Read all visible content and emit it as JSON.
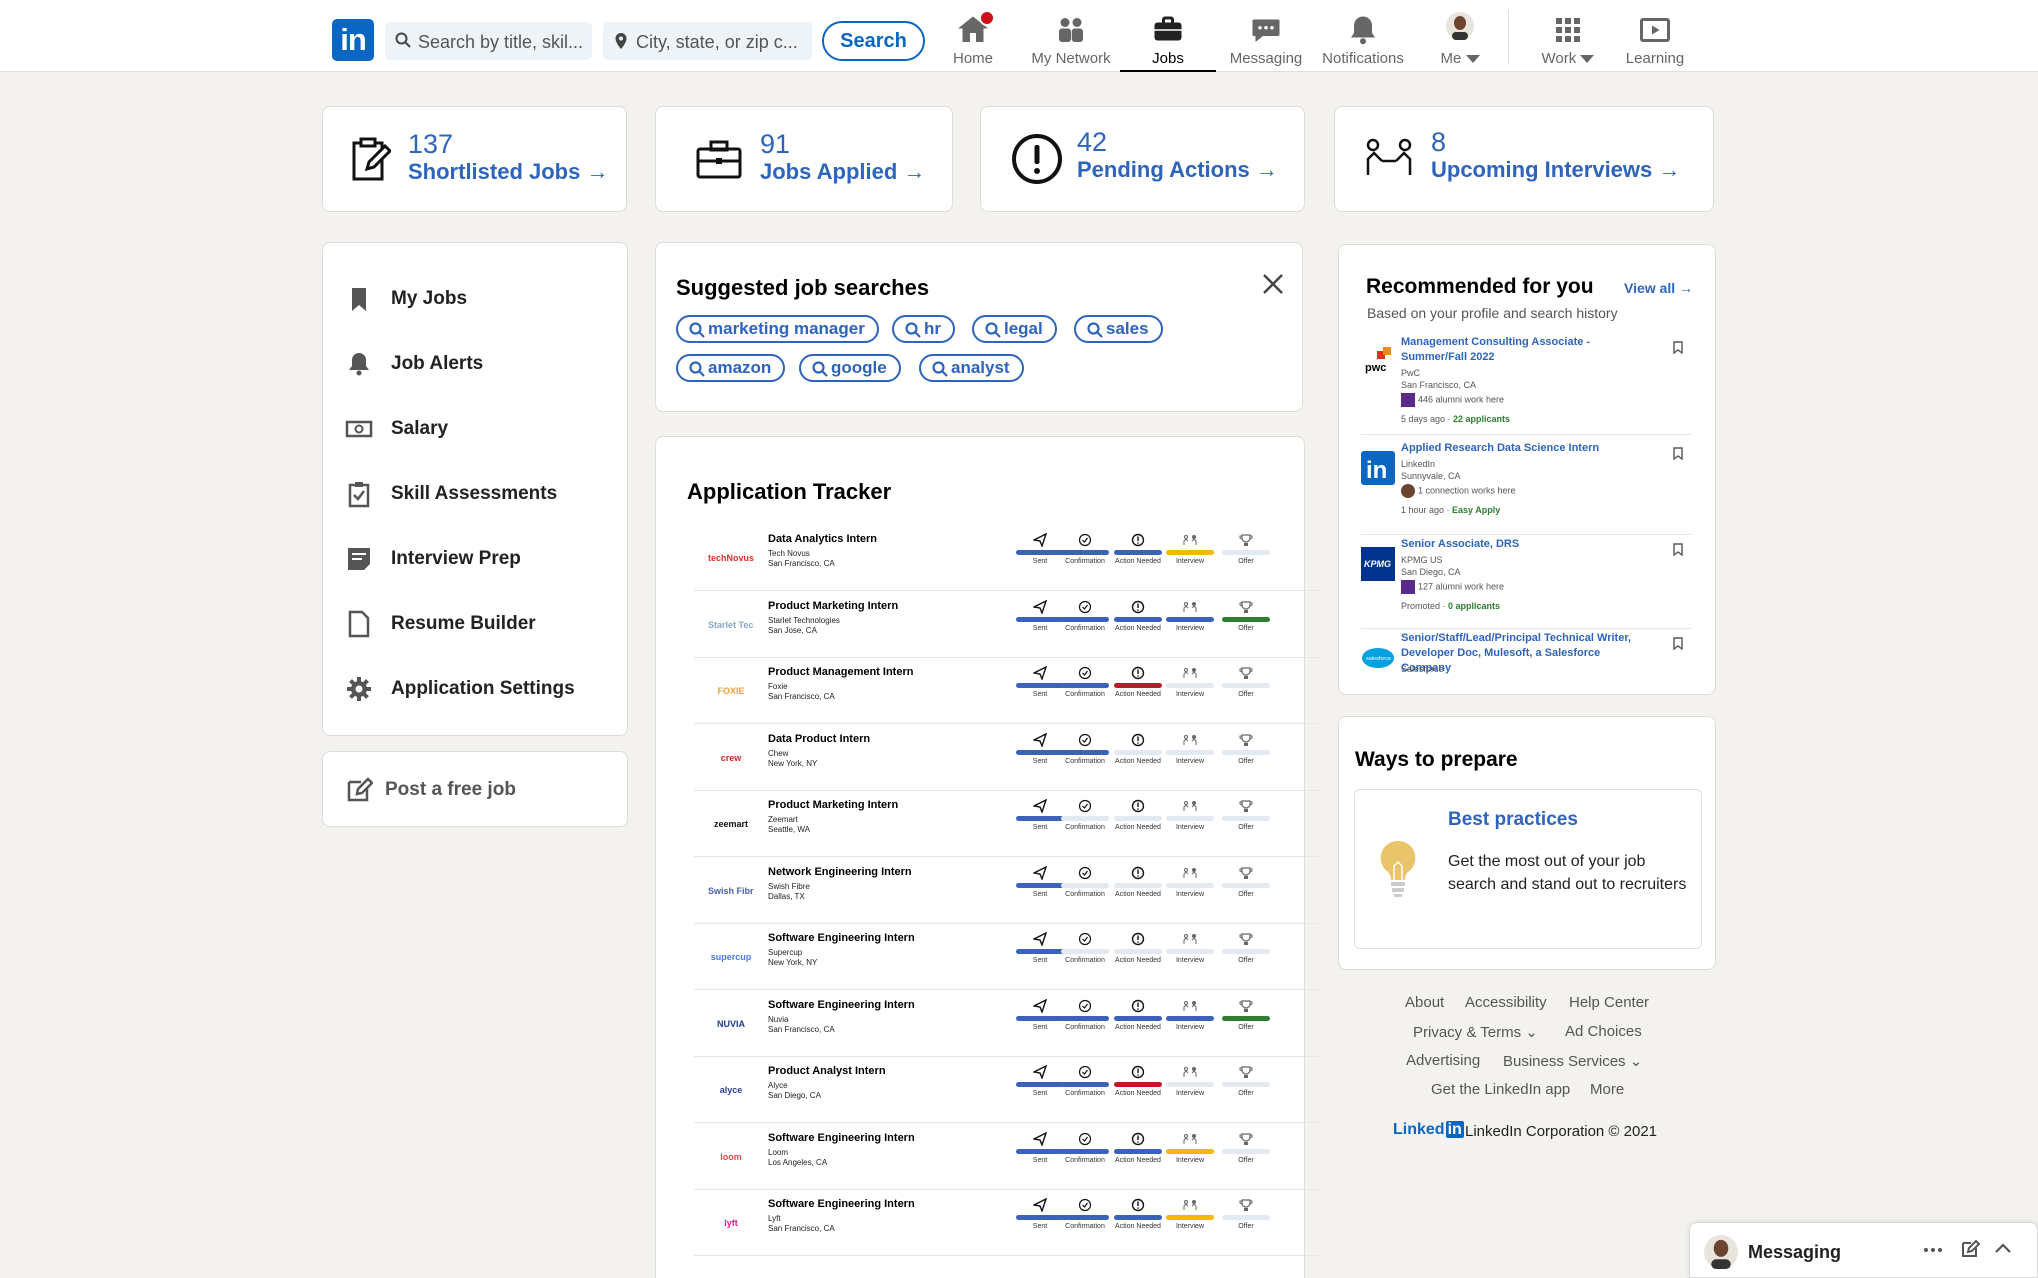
{
  "nav": {
    "logo": "in",
    "search_placeholder": "Search by title, skil...",
    "location_placeholder": "City, state, or zip c...",
    "search_button": "Search",
    "items": [
      {
        "label": "Home"
      },
      {
        "label": "My Network"
      },
      {
        "label": "Jobs"
      },
      {
        "label": "Messaging"
      },
      {
        "label": "Notifications"
      },
      {
        "label": "Me"
      },
      {
        "label": "Work"
      },
      {
        "label": "Learning"
      }
    ]
  },
  "stats": [
    {
      "number": "137",
      "label": "Shortlisted Jobs →"
    },
    {
      "number": "91",
      "label": "Jobs Applied →"
    },
    {
      "number": "42",
      "label": "Pending Actions →"
    },
    {
      "number": "8",
      "label": "Upcoming Interviews →"
    }
  ],
  "sidebar": {
    "items": [
      {
        "label": "My Jobs",
        "icon": "bookmark-icon"
      },
      {
        "label": "Job Alerts",
        "icon": "bell-icon"
      },
      {
        "label": "Salary",
        "icon": "money-icon"
      },
      {
        "label": "Skill Assessments",
        "icon": "clipboard-check-icon"
      },
      {
        "label": "Interview Prep",
        "icon": "notes-icon"
      },
      {
        "label": "Resume Builder",
        "icon": "document-icon"
      },
      {
        "label": "Application Settings",
        "icon": "gear-icon"
      }
    ],
    "post_job": "Post a free job"
  },
  "suggested": {
    "title": "Suggested job searches",
    "pills": [
      "marketing manager",
      "hr",
      "legal",
      "sales",
      "amazon",
      "google",
      "analyst"
    ]
  },
  "tracker": {
    "title": "Application Tracker",
    "stages": [
      "Sent",
      "Confirmation",
      "Action Needed",
      "Interview",
      "Offer"
    ],
    "colors": {
      "done": "#3a62b8",
      "pending": "#e4e8ef",
      "action": "#c0182a",
      "interview": "#f5b800",
      "offer": "#2f7d32"
    },
    "rows": [
      {
        "title": "Data Analytics Intern",
        "company": "Tech Novus",
        "location": "San Francisco, CA",
        "logo": "techNovus",
        "logo_color": "#d9342b",
        "status": [
          "done",
          "done",
          "done",
          "interview",
          "pending"
        ]
      },
      {
        "title": "Product Marketing Intern",
        "company": "Starlet Technologies",
        "location": "San Jose, CA",
        "logo": "Starlet Technologies",
        "logo_color": "#8aa6c8",
        "status": [
          "done",
          "done",
          "done",
          "done",
          "offer"
        ]
      },
      {
        "title": "Product Management Intern",
        "company": "Foxie",
        "location": "San Francisco, CA",
        "logo": "FOXIE",
        "logo_color": "#e8a23a",
        "status": [
          "done",
          "done",
          "action",
          "pending",
          "pending"
        ]
      },
      {
        "title": "Data Product Intern",
        "company": "Chew",
        "location": "New York, NY",
        "logo": "crew",
        "logo_color": "#d8202a",
        "status": [
          "done",
          "done",
          "pending",
          "pending",
          "pending"
        ]
      },
      {
        "title": "Product Marketing Intern",
        "company": "Zeemart",
        "location": "Seattle, WA",
        "logo": "zeemart",
        "logo_color": "#111111",
        "status": [
          "done",
          "pending",
          "pending",
          "pending",
          "pending"
        ]
      },
      {
        "title": "Network Engineering Intern",
        "company": "Swish Fibre",
        "location": "Dallas, TX",
        "logo": "Swish Fibre",
        "logo_color": "#4a5fb0",
        "status": [
          "done",
          "pending",
          "pending",
          "pending",
          "pending"
        ]
      },
      {
        "title": "Software Engineering Intern",
        "company": "Supercup",
        "location": "New York, NY",
        "logo": "supercup",
        "logo_color": "#4a7ae0",
        "status": [
          "done",
          "pending",
          "pending",
          "pending",
          "pending"
        ]
      },
      {
        "title": "Software Engineering Intern",
        "company": "Nuvia",
        "location": "San Francisco, CA",
        "logo": "NUVIA",
        "logo_color": "#1e3d96",
        "status": [
          "done",
          "done",
          "done",
          "done",
          "offer"
        ]
      },
      {
        "title": "Product Analyst Intern",
        "company": "Alyce",
        "location": "San Diego, CA",
        "logo": "alyce",
        "logo_color": "#2a3fa0",
        "status": [
          "done",
          "done",
          "action",
          "pending",
          "pending"
        ]
      },
      {
        "title": "Software Engineering Intern",
        "company": "Loom",
        "location": "Los Angeles, CA",
        "logo": "loom",
        "logo_color": "#e0484f",
        "status": [
          "done",
          "done",
          "done",
          "interview",
          "pending"
        ]
      },
      {
        "title": "Software Engineering Intern",
        "company": "Lyft",
        "location": "San Francisco, CA",
        "logo": "lyft",
        "logo_color": "#e9158c",
        "status": [
          "done",
          "done",
          "done",
          "interview",
          "pending"
        ]
      }
    ]
  },
  "recommended": {
    "title": "Recommended for you",
    "view_all": "View all →",
    "subtitle": "Based on your profile and search history",
    "items": [
      {
        "title": "Management Consulting Associate - Summer/Fall 2022",
        "company": "PwC",
        "location": "San Francisco, CA",
        "meta": "446 alumni work here",
        "footer_a": "5 days ago · ",
        "footer_b": "22 applicants",
        "logo": "pwc"
      },
      {
        "title": "Applied Research Data Science Intern",
        "company": "LinkedIn",
        "location": "Sunnyvale, CA",
        "meta": "1 connection works here",
        "footer_a": "1 hour ago · ",
        "footer_b": "Easy Apply",
        "logo": "in"
      },
      {
        "title": "Senior Associate, DRS",
        "company": "KPMG US",
        "location": "San Diego, CA",
        "meta": "127 alumni work here",
        "footer_a": "Promoted · ",
        "footer_b": "0 applicants",
        "logo": "KPMG"
      },
      {
        "title": "Senior/Staff/Lead/Principal Technical Writer, Developer Doc, Mulesoft, a Salesforce Company",
        "company": "Salesforce",
        "location": "",
        "meta": "",
        "footer_a": "",
        "footer_b": "",
        "logo": "salesforce"
      }
    ]
  },
  "prepare": {
    "title": "Ways to prepare",
    "link": "Best practices",
    "text": "Get the most out of your job search and stand out to recruiters"
  },
  "footer": {
    "links": [
      "About",
      "Accessibility",
      "Help Center",
      "Privacy & Terms",
      "Ad Choices",
      "Advertising",
      "Business Services",
      "Get the LinkedIn app",
      "More"
    ],
    "brand": "Linked",
    "brand_in": "in",
    "copyright": "LinkedIn Corporation © 2021"
  },
  "messaging": {
    "label": "Messaging"
  }
}
